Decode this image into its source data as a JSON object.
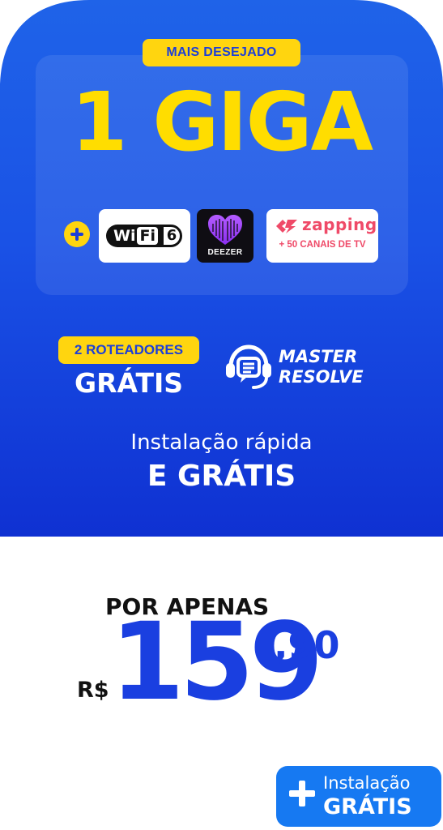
{
  "offer": {
    "badge": "MAIS DESEJADO",
    "headline": "1 GIGA",
    "extras": {
      "wifi": {
        "brand": "Wi",
        "fi": "Fi",
        "version": "6"
      },
      "deezer": {
        "label": "DEEZER"
      },
      "zapping": {
        "name": "zapping",
        "subtitle": "+ 50 CANAIS DE TV"
      }
    },
    "routers": {
      "pill": "2 ROTEADORES",
      "free": "GRÁTIS"
    },
    "support": {
      "line1": "MASTER",
      "line2": "RESOLVE"
    },
    "installation": {
      "line1": "Instalação rápida",
      "line2": "E GRÁTIS"
    }
  },
  "price": {
    "label": "POR APENAS",
    "currency": "R$",
    "integer": "159",
    "decimal": ",90"
  },
  "cta": {
    "line1": "Instalação",
    "line2": "GRÁTIS"
  },
  "colors": {
    "card_blue": "#1a52e6",
    "accent_yellow": "#ffd50f",
    "price_blue": "#1a3fe0",
    "cta_blue": "#1679f2",
    "zapping_pink": "#ef4a68"
  }
}
